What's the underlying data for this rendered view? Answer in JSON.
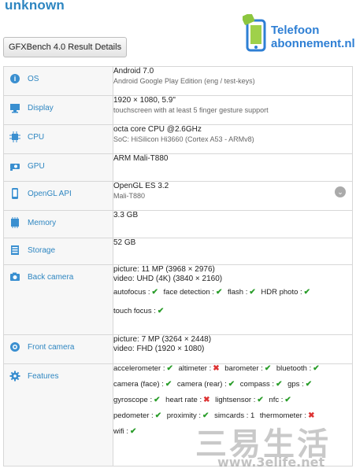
{
  "header": {
    "title": "unknown",
    "tab_label": "GFXBench 4.0 Result Details",
    "logo_line1": "Telefoon",
    "logo_line2": "abonnement.nl"
  },
  "specs": [
    {
      "label": "OS",
      "icon": "os-icon",
      "line1": "Android 7.0",
      "line2": "Android Google Play Edition (eng / test-keys)"
    },
    {
      "label": "Display",
      "icon": "display-icon",
      "line1": "1920 × 1080, 5.9\"",
      "line2": "touchscreen with at least 5 finger gesture support"
    },
    {
      "label": "CPU",
      "icon": "cpu-icon",
      "line1": "octa core CPU @2.6GHz",
      "line2": "SoC: HiSilicon Hi3660 (Cortex A53 - ARMv8)"
    },
    {
      "label": "GPU",
      "icon": "gpu-icon",
      "line1": "ARM Mali-T880",
      "line2": ""
    },
    {
      "label": "OpenGL API",
      "icon": "opengl-icon",
      "line1": "OpenGL ES 3.2",
      "line2": "Mali-T880"
    },
    {
      "label": "Memory",
      "icon": "memory-icon",
      "line1": "3.3 GB",
      "line2": ""
    },
    {
      "label": "Storage",
      "icon": "storage-icon",
      "line1": "52 GB",
      "line2": ""
    }
  ],
  "back_camera": {
    "label": "Back camera",
    "picture": "picture: 11 MP (3968 × 2976)",
    "video": "video: UHD (4K) (3840 × 2160)",
    "features_row1": [
      {
        "name": "autofocus :",
        "ok": true
      },
      {
        "name": "face detection :",
        "ok": true
      },
      {
        "name": "flash :",
        "ok": true
      },
      {
        "name": "HDR photo :",
        "ok": true
      }
    ],
    "features_row2": [
      {
        "name": "touch focus :",
        "ok": true
      }
    ]
  },
  "front_camera": {
    "label": "Front camera",
    "picture": "picture: 7 MP (3264 × 2448)",
    "video": "video: FHD (1920 × 1080)"
  },
  "features": {
    "label": "Features",
    "rows": [
      [
        {
          "name": "accelerometer :",
          "ok": true
        },
        {
          "name": "altimeter :",
          "ok": false
        },
        {
          "name": "barometer :",
          "ok": true
        },
        {
          "name": "bluetooth :",
          "ok": true
        }
      ],
      [
        {
          "name": "camera (face) :",
          "ok": true
        },
        {
          "name": "camera (rear) :",
          "ok": true
        },
        {
          "name": "compass :",
          "ok": true
        },
        {
          "name": "gps :",
          "ok": true
        }
      ],
      [
        {
          "name": "gyroscope :",
          "ok": true
        },
        {
          "name": "heart rate :",
          "ok": false
        },
        {
          "name": "lightsensor :",
          "ok": true
        },
        {
          "name": "nfc :",
          "ok": true
        }
      ],
      [
        {
          "name": "pedometer :",
          "ok": true
        },
        {
          "name": "proximity :",
          "ok": true
        },
        {
          "name": "simcards : 1",
          "ok": null
        },
        {
          "name": "thermometer :",
          "ok": false
        }
      ],
      [
        {
          "name": "wifi :",
          "ok": true
        }
      ]
    ]
  },
  "watermark": {
    "big": "三易生活",
    "small": "www.3elife.net"
  },
  "colors": {
    "accent": "#2e86c1",
    "check": "#2a9d2a",
    "cross": "#dd3333"
  }
}
